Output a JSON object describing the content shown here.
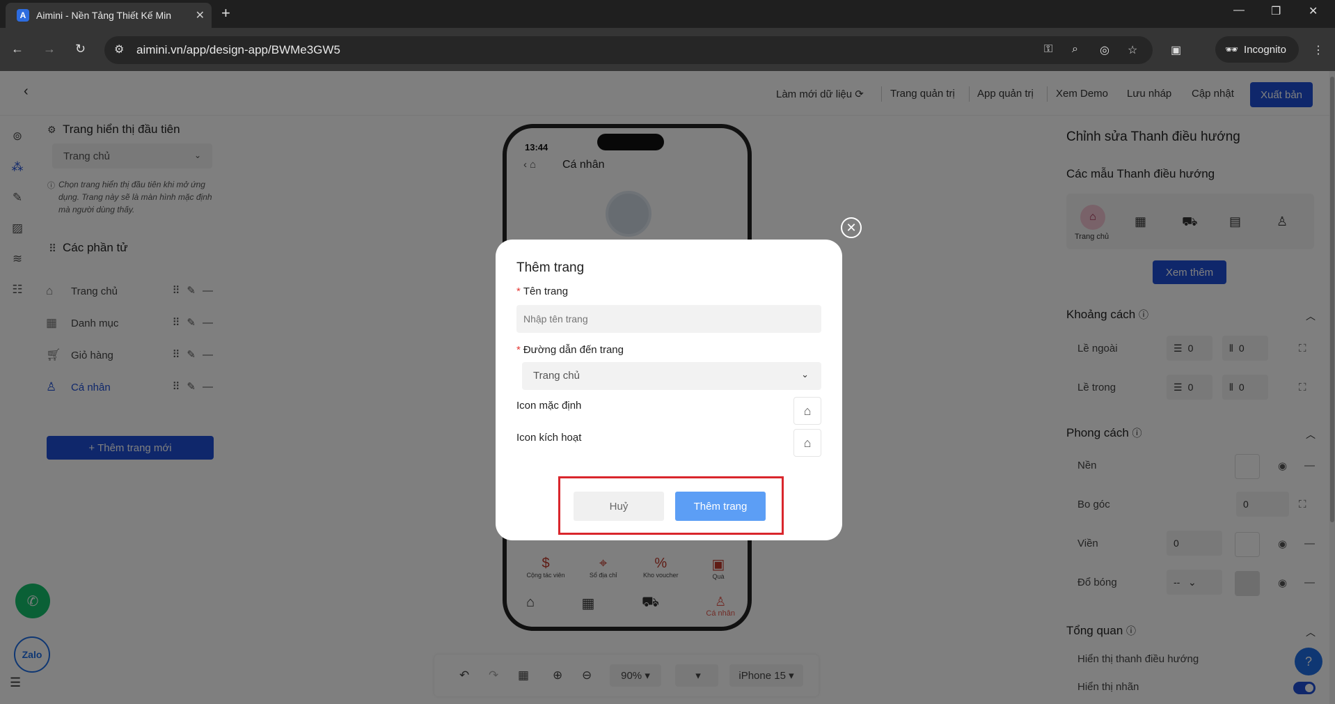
{
  "browser": {
    "tab_title": "Aimini - Nền Tảng Thiết Kế Min",
    "favicon_letter": "A",
    "url": "aimini.vn/app/design-app/BWMe3GW5",
    "incognito_label": "Incognito"
  },
  "toolbar": {
    "refresh_data": "Làm mới dữ liệu",
    "admin_page": "Trang quản trị",
    "admin_app": "App quản trị",
    "demo": "Xem Demo",
    "save_draft": "Lưu nháp",
    "update": "Cập nhật",
    "publish": "Xuất bản"
  },
  "left_panel": {
    "first_page_title": "Trang hiển thị đầu tiên",
    "first_page_value": "Trang chủ",
    "note": "Chọn trang hiển thị đầu tiên khi mở ứng dụng. Trang này sẽ là màn hình mặc định mà người dùng thấy.",
    "elements_title": "Các phần tử",
    "pages": [
      {
        "label": "Trang chủ"
      },
      {
        "label": "Danh mục"
      },
      {
        "label": "Giỏ hàng"
      },
      {
        "label": "Cá nhân"
      }
    ],
    "add_page": "+ Thêm trang mới"
  },
  "phone": {
    "time": "13:44",
    "title": "Cá nhân",
    "quick_links": [
      "Cộng tác viên",
      "Sổ địa chỉ",
      "Kho voucher",
      "Quà"
    ],
    "active_nav": "Cá nhân"
  },
  "bottom_toolbar": {
    "zoom": "90%",
    "device": "iPhone 15"
  },
  "right_panel": {
    "title": "Chỉnh sửa Thanh điều hướng",
    "templates_title": "Các mẫu Thanh điều hướng",
    "template_home_label": "Trang chủ",
    "see_more": "Xem thêm",
    "spacing_title": "Khoảng cách",
    "margin_label": "Lề ngoài",
    "padding_label": "Lề trong",
    "margin_v": "0",
    "margin_h": "0",
    "padding_v": "0",
    "padding_h": "0",
    "style_title": "Phong cách",
    "bg_label": "Nền",
    "radius_label": "Bo góc",
    "radius_value": "0",
    "border_label": "Viền",
    "border_value": "0",
    "shadow_label": "Đổ bóng",
    "shadow_value": "--",
    "overview_title": "Tổng quan",
    "show_nav_label": "Hiển thị thanh điều hướng",
    "show_label_label": "Hiển thị nhãn"
  },
  "modal": {
    "title": "Thêm trang",
    "name_label": "Tên trang",
    "name_placeholder": "Nhập tên trang",
    "path_label": "Đường dẫn đến trang",
    "path_value": "Trang chủ",
    "default_icon_label": "Icon mặc định",
    "active_icon_label": "Icon kích hoạt",
    "cancel": "Huỷ",
    "submit": "Thêm trang"
  },
  "floating": {
    "zalo": "Zalo",
    "help": "?"
  },
  "colors": {
    "accent": "#1f4fd6",
    "submit": "#5c9ef5",
    "highlight": "#d9262c"
  }
}
